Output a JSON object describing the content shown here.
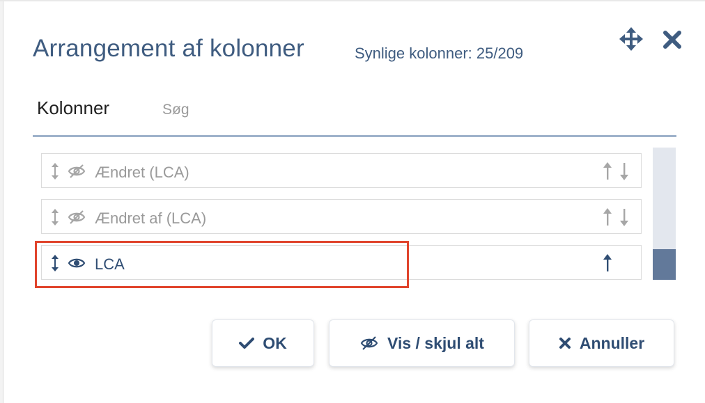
{
  "dialog": {
    "title": "Arrangement af kolonner",
    "visible_count": "Synlige kolonner: 25/209",
    "move_icon": "move-arrows-icon",
    "close_icon": "close-x-icon"
  },
  "tabs": [
    {
      "label": "Kolonner",
      "active": true
    },
    {
      "label": "Søg",
      "active": false
    }
  ],
  "columns": [
    {
      "label": "Ændret (LCA)",
      "visible": false,
      "can_move_up": true,
      "can_move_down": true
    },
    {
      "label": "Ændret af (LCA)",
      "visible": false,
      "can_move_up": true,
      "can_move_down": true
    },
    {
      "label": "LCA",
      "visible": true,
      "can_move_up": true,
      "can_move_down": false
    }
  ],
  "buttons": {
    "ok_label": "OK",
    "toggle_all_label": "Vis / skjul alt",
    "cancel_label": "Annuller"
  },
  "colors": {
    "accent": "#3f5c80",
    "highlight": "#e0442c",
    "scroll_thumb": "#62799a",
    "hidden_text": "#9a9a9a"
  }
}
